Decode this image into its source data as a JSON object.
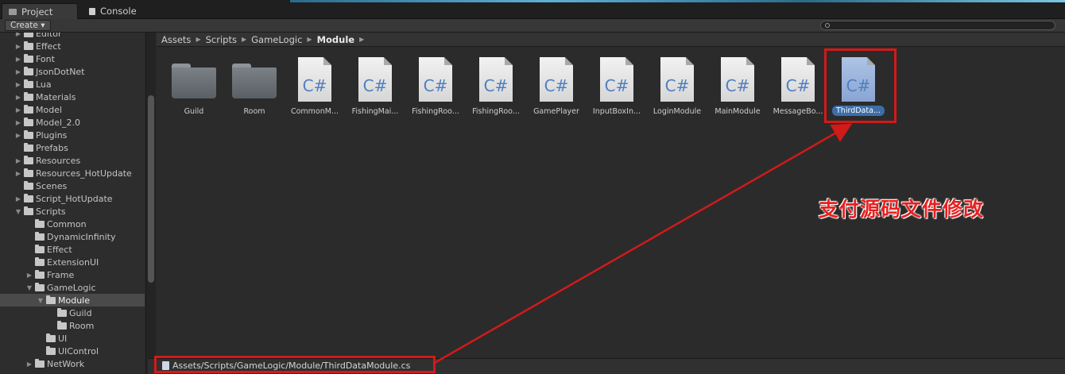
{
  "tabs": [
    {
      "label": "Project",
      "icon": "project-icon",
      "active": true
    },
    {
      "label": "Console",
      "icon": "console-icon",
      "active": false
    }
  ],
  "toolbar": {
    "create_label": "Create ▾",
    "search_placeholder": ""
  },
  "tree": [
    {
      "label": "Editor",
      "depth": 1,
      "arrow": "▶"
    },
    {
      "label": "Effect",
      "depth": 1,
      "arrow": "▶"
    },
    {
      "label": "Font",
      "depth": 1,
      "arrow": "▶"
    },
    {
      "label": "JsonDotNet",
      "depth": 1,
      "arrow": "▶"
    },
    {
      "label": "Lua",
      "depth": 1,
      "arrow": "▶"
    },
    {
      "label": "Materials",
      "depth": 1,
      "arrow": "▶"
    },
    {
      "label": "Model",
      "depth": 1,
      "arrow": "▶"
    },
    {
      "label": "Model_2.0",
      "depth": 1,
      "arrow": "▶"
    },
    {
      "label": "Plugins",
      "depth": 1,
      "arrow": "▶"
    },
    {
      "label": "Prefabs",
      "depth": 1,
      "arrow": ""
    },
    {
      "label": "Resources",
      "depth": 1,
      "arrow": "▶"
    },
    {
      "label": "Resources_HotUpdate",
      "depth": 1,
      "arrow": "▶"
    },
    {
      "label": "Scenes",
      "depth": 1,
      "arrow": ""
    },
    {
      "label": "Script_HotUpdate",
      "depth": 1,
      "arrow": "▶"
    },
    {
      "label": "Scripts",
      "depth": 1,
      "arrow": "▼"
    },
    {
      "label": "Common",
      "depth": 2,
      "arrow": ""
    },
    {
      "label": "DynamicInfinity",
      "depth": 2,
      "arrow": ""
    },
    {
      "label": "Effect",
      "depth": 2,
      "arrow": ""
    },
    {
      "label": "ExtensionUI",
      "depth": 2,
      "arrow": ""
    },
    {
      "label": "Frame",
      "depth": 2,
      "arrow": "▶"
    },
    {
      "label": "GameLogic",
      "depth": 2,
      "arrow": "▼"
    },
    {
      "label": "Module",
      "depth": 3,
      "arrow": "▼",
      "selected": true
    },
    {
      "label": "Guild",
      "depth": 4,
      "arrow": ""
    },
    {
      "label": "Room",
      "depth": 4,
      "arrow": ""
    },
    {
      "label": "UI",
      "depth": 3,
      "arrow": ""
    },
    {
      "label": "UIControl",
      "depth": 3,
      "arrow": ""
    },
    {
      "label": "NetWork",
      "depth": 2,
      "arrow": "▶"
    }
  ],
  "breadcrumb": [
    "Assets",
    "Scripts",
    "GameLogic",
    "Module"
  ],
  "assets": [
    {
      "label": "Guild",
      "kind": "folder"
    },
    {
      "label": "Room",
      "kind": "folder"
    },
    {
      "label": "CommonM...",
      "kind": "cs"
    },
    {
      "label": "FishingMai...",
      "kind": "cs"
    },
    {
      "label": "FishingRoo...",
      "kind": "cs"
    },
    {
      "label": "FishingRoo...",
      "kind": "cs"
    },
    {
      "label": "GamePlayer",
      "kind": "cs"
    },
    {
      "label": "InputBoxIn...",
      "kind": "cs"
    },
    {
      "label": "LoginModule",
      "kind": "cs"
    },
    {
      "label": "MainModule",
      "kind": "cs"
    },
    {
      "label": "MessageBo...",
      "kind": "cs"
    },
    {
      "label": "ThirdData...",
      "kind": "cs",
      "selected": true
    }
  ],
  "cs_glyph": "C#",
  "annotation_text": "支付源码文件修改",
  "status_path": "Assets/Scripts/GameLogic/Module/ThirdDataModule.cs",
  "colors": {
    "annotation": "#e82020",
    "selection": "#3d6ea8",
    "highlight": "#d11a1a"
  }
}
